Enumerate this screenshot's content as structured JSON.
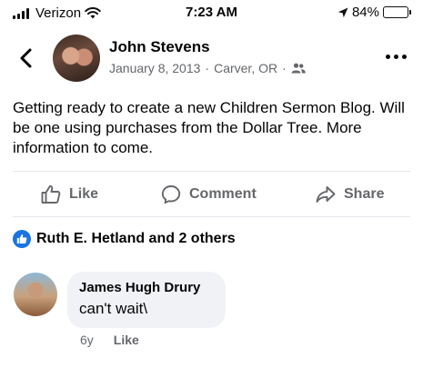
{
  "status_bar": {
    "carrier": "Verizon",
    "time": "7:23 AM",
    "battery_text": "84%",
    "battery_level": 0.84
  },
  "post": {
    "author": "John Stevens",
    "date": "January 8, 2013",
    "location": "Carver, OR",
    "separator": "·",
    "text": "Getting ready to create a new Children Sermon Blog. Will be one using purchases from the Dollar Tree. More information to come.",
    "actions": {
      "like": "Like",
      "comment": "Comment",
      "share": "Share"
    },
    "reactions_text": "Ruth E. Hetland and 2 others"
  },
  "comment": {
    "author": "James Hugh Drury",
    "text": "can't wait\\",
    "age": "6y",
    "like": "Like"
  },
  "colors": {
    "accent_blue": "#1b74e4",
    "secondary_text": "#65676b",
    "bubble_bg": "#f0f2f5"
  },
  "icons": [
    "signal-icon",
    "wifi-icon",
    "location-arrow-icon",
    "battery-icon",
    "back-chevron-icon",
    "friends-audience-icon",
    "more-options-icon",
    "thumbs-up-icon",
    "comment-bubble-icon",
    "share-arrow-icon",
    "like-reaction-icon"
  ]
}
